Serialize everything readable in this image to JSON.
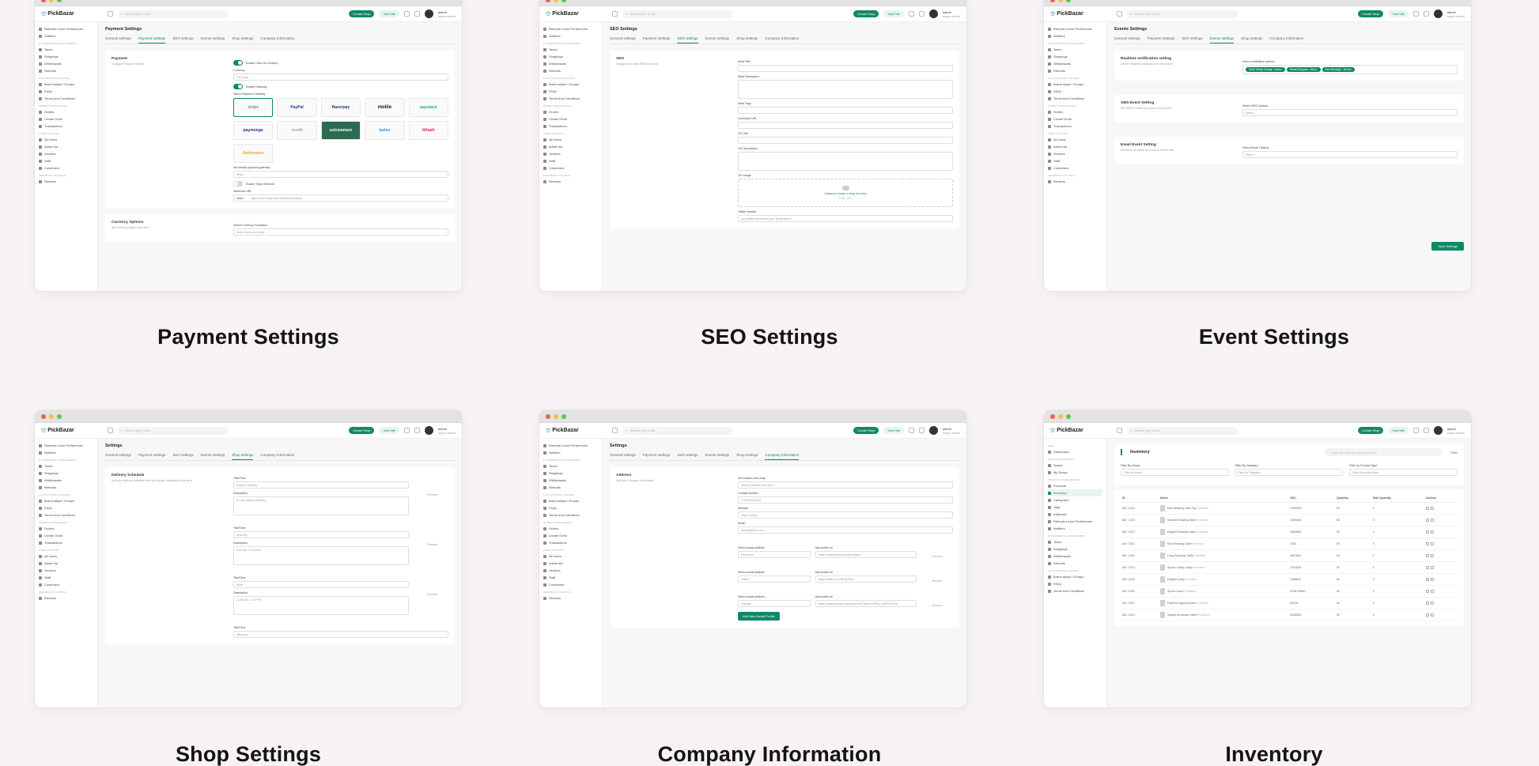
{
  "app": {
    "logo": "PickBazar",
    "search_placeholder": "Search your route...",
    "create_shop": "Create Shop",
    "visit_site": "Visit Site",
    "user_name": "admin",
    "user_role": "super admin",
    "accent": "#0f8a67"
  },
  "sidebar": {
    "dashboard": "Dashboard",
    "my_shops": "My Shops",
    "groups": [
      {
        "head": "",
        "items": [
          "Refunds Learn Preferences",
          "Notifiers"
        ]
      },
      {
        "head": "E-commerce Management",
        "items": [
          "Taxes",
          "Shippings",
          "Withdrawals",
          "Refunds"
        ]
      },
      {
        "head": "Layout/Page Control",
        "items": [
          "Brand adapt / Groups",
          "FAQs",
          "Terms And Conditions"
        ]
      },
      {
        "head": "Order Management",
        "items": [
          "Orders",
          "Create Order",
          "Transactions"
        ]
      },
      {
        "head": "User Control",
        "items": [
          "All Users",
          "Admin list",
          "Vendors",
          "Staff",
          "Customers"
        ]
      },
      {
        "head": "Feedback Control",
        "items": [
          "Reviews"
        ]
      }
    ],
    "inventory_groups": [
      {
        "head": "Main",
        "items": [
          "Dashboard"
        ]
      },
      {
        "head": "Shop Management",
        "items": [
          "Shops",
          "My Shops"
        ]
      },
      {
        "head": "Product Management",
        "items": [
          "Products",
          "Inventory",
          "Categories",
          "Tags",
          "Attributes",
          "Refunds Learn Preferences",
          "Notifiers"
        ]
      },
      {
        "head": "E-commerce Management",
        "items": [
          "Taxes",
          "Shippings",
          "Withdrawals",
          "Refunds"
        ]
      },
      {
        "head": "Layout/Page Control",
        "items": [
          "Brand adapt / Groups",
          "FAQs",
          "Terms And Conditions"
        ]
      }
    ]
  },
  "tabs": [
    "General settings",
    "Payment settings",
    "SEO settings",
    "Events settings",
    "Shop settings",
    "Company Information"
  ],
  "captions": {
    "payment": "Payment Settings",
    "seo": "SEO Settings",
    "event": "Event Settings",
    "shop": "Shop Settings",
    "company": "Company Information",
    "inventory": "Inventory"
  },
  "payment": {
    "title": "Payment Settings",
    "section_title": "Payment",
    "section_sub": "Configure Payment Option",
    "cod_toggle": "Enable Cash On Delivery",
    "currency_label": "Currency",
    "currency_value": "US Dollar",
    "gateway_toggle": "Enable Gateway",
    "gateway_label": "Select Payment Gateway",
    "gateways": [
      "stripe",
      "PayPal",
      "Razorpay",
      "mollie",
      "paystack",
      "paymongo",
      "xendit",
      "sslcommerz",
      "iyzico",
      "bKash",
      "flutterwave"
    ],
    "default_gateway_label": "Set default payment gateway",
    "default_gateway_value": "Stripe",
    "stripe_element": "Enable Stripe Element",
    "webhook_label": "Webhook URL",
    "webhook_prefix": "stripe",
    "webhook_value": "https://marvel-api.redq.io/webhooks/stripe",
    "currency_options_title": "Currency Options",
    "currency_options_sub": "Set Currency option from here",
    "currency_format_label": "Select Currency Formation",
    "currency_format_value": "Select currency format..."
  },
  "seo": {
    "title": "SEO Settings",
    "section_title": "SEO",
    "section_sub": "Change your site's SEO from here",
    "fields": [
      "Meta Title",
      "Meta Description",
      "Meta Tags",
      "Canonical URL",
      "OG Title",
      "OG Description",
      "OG Image"
    ],
    "upload_text": "Upload an image or drag and drop",
    "upload_hint": "PNG, JPG",
    "twitter_label": "Twitter Handle",
    "twitter_placeholder": "your twitter username (exp: @username)"
  },
  "event": {
    "title": "Events Settings",
    "realtime_title": "Realtime notification setting",
    "realtime_sub": "Set the Realtime notification for the events",
    "realtime_label": "Select notification options",
    "chips": [
      "Order Status Change - Admin",
      "Refund Request - Admin",
      "New Message - Vendor"
    ],
    "sms_title": "SMS Event Setting",
    "sms_sub": "Set SMS for which you want to send SMS",
    "sms_label": "Select SMS Options",
    "email_title": "Email Event Setting",
    "email_sub": "Set Email for which you want to send Email",
    "email_label": "Select Email Options",
    "select_placeholder": "Select...",
    "save_button": "Save Settings"
  },
  "shop": {
    "title": "Settings",
    "section_title": "Delivery Schedule",
    "section_sub": "Add your delivery schedule time with proper description from here",
    "title_label": "Title/Time",
    "desc_label": "Description",
    "remove": "Remove",
    "schedules": [
      {
        "title": "Express Delivery",
        "desc": "90 min express delivery"
      },
      {
        "title": "Morning",
        "desc": "8.00 AM - 11.00 AM"
      },
      {
        "title": "Noon",
        "desc": "11.00 AM - 2.00 PM"
      },
      {
        "title": "Afternoon",
        "desc": ""
      }
    ]
  },
  "company": {
    "title": "Settings",
    "section_title": "Address",
    "section_sub": "Add your company information",
    "location_label": "Set location from map",
    "location_placeholder": "Search location from here",
    "contact_label": "Contact Number",
    "contact_value": "+129290122122",
    "website_label": "Website",
    "website_value": "https://redq.io",
    "email_label": "Email",
    "email_value": "demo@demo.com",
    "social_label": "Select social platform",
    "url_label": "Add profile url",
    "socials": [
      {
        "platform": "Facebook",
        "url": "https://www.facebook.com/redqinc/"
      },
      {
        "platform": "Twitter",
        "url": "https://twitter.com/RedqTeam"
      },
      {
        "platform": "Youtube",
        "url": "https://www.youtube.com/channel/UCjld1tyVHRNy_pe3ROLiLhw"
      }
    ],
    "remove": "Remove",
    "add_button": "Add New Social Profile"
  },
  "inventory": {
    "title": "Inventory",
    "search_placeholder": "Type your query and press enter",
    "filter": "Filter",
    "filter_labels": [
      "Filter By Group",
      "Filter By Category",
      "Filter by Product Type"
    ],
    "filter_placeholders": [
      "Filter by Group",
      "Filter by Category",
      "Filter by product type"
    ],
    "columns": [
      "ID",
      "Name",
      "SKU",
      "Quantity",
      "Sold Quantity",
      "Actions"
    ],
    "rows": [
      {
        "id": "#ID: 1024",
        "name": "Kids Wearing Tank Top",
        "group": "Furniture",
        "sku": "9789255",
        "qty": "50",
        "sold": "0"
      },
      {
        "id": "#ID: 1023",
        "name": "Student Reading Table",
        "group": "Furniture",
        "sku": "2255484",
        "qty": "50",
        "sold": "0"
      },
      {
        "id": "#ID: 1022",
        "name": "Elegant Reading Table",
        "group": "Furniture",
        "sku": "5569889",
        "qty": "50",
        "sold": "0"
      },
      {
        "id": "#ID: 1021",
        "name": "Kids Reading Table",
        "group": "Furniture",
        "sku": "2254",
        "qty": "50",
        "sold": "0"
      },
      {
        "id": "#ID: 1020",
        "name": "Long Standing Table",
        "group": "Furniture",
        "sku": "5647892",
        "qty": "50",
        "sold": "0"
      },
      {
        "id": "#ID: 1019",
        "name": "Spoon Candy Lamp",
        "group": "Furniture",
        "sku": "1251548",
        "qty": "50",
        "sold": "0"
      },
      {
        "id": "#ID: 1018",
        "name": "Elegant Lamp",
        "group": "Furniture",
        "sku": "2458632",
        "qty": "50",
        "sold": "0"
      },
      {
        "id": "#ID: 1016",
        "name": "Spoon Lamp",
        "group": "Furniture",
        "sku": "5248745663",
        "qty": "50",
        "sold": "0"
      },
      {
        "id": "#ID: 1015",
        "name": "Fabricio Argama Abem",
        "group": "Furniture",
        "sku": "85236",
        "qty": "50",
        "sold": "0"
      },
      {
        "id": "#ID: 1014",
        "name": "Sybam Armchaire Albert",
        "group": "Furniture",
        "sku": "2545569",
        "qty": "50",
        "sold": "0"
      }
    ]
  }
}
